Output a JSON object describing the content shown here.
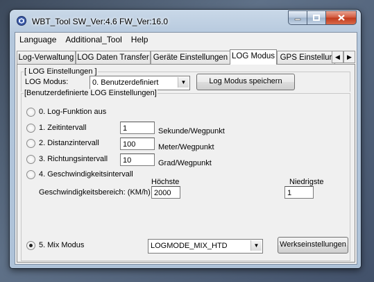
{
  "window": {
    "title": "WBT_Tool  SW_Ver:4.6  FW_Ver:16.0"
  },
  "menu": {
    "items": [
      "Language",
      "Additional_Tool",
      "Help"
    ]
  },
  "tabs": [
    "Log-Verwaltung",
    "LOG Daten Transfer",
    "Geräte Einstellungen",
    "LOG Modus",
    "GPS Einstellur"
  ],
  "log_settings": {
    "legend": "[ LOG Einstellungen ]",
    "mode_label": "LOG Modus:",
    "mode_value": "0. Benutzerdefiniert",
    "save_button": "Log Modus speichern"
  },
  "custom": {
    "legend": "[Benutzerdefinierte LOG Einstellungen]",
    "opt0": "0. Log-Funktion aus",
    "opt1": "1. Zeitintervall",
    "opt1_value": "1",
    "opt1_unit": "Sekunde/Wegpunkt",
    "opt2": "2. Distanzintervall",
    "opt2_value": "100",
    "opt2_unit": "Meter/Wegpunkt",
    "opt3": "3. Richtungsintervall",
    "opt3_value": "10",
    "opt3_unit": "Grad/Wegpunkt",
    "opt4": "4. Geschwindigkeitsintervall",
    "max_label": "Höchste",
    "min_label": "Niedrigste",
    "range_label": "Geschwindigkeitsbereich: (KM/h)",
    "max_value": "2000",
    "min_value": "1",
    "opt5": "5. Mix Modus",
    "mix_value": "LOGMODE_MIX_HTD",
    "factory_button": "Werkseinstellungen",
    "selected": 5
  }
}
